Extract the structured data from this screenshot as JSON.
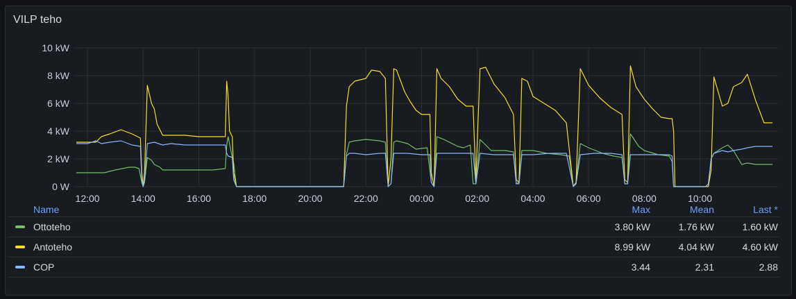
{
  "panel": {
    "title": "VILP teho"
  },
  "legend": {
    "headers": {
      "name": "Name",
      "max": "Max",
      "mean": "Mean",
      "last": "Last *"
    },
    "rows": [
      {
        "name": "Ottoteho",
        "color": "#73bf69",
        "max": "3.80 kW",
        "mean": "1.76 kW",
        "last": "1.60 kW"
      },
      {
        "name": "Antoteho",
        "color": "#fade2a",
        "max": "8.99 kW",
        "mean": "4.04 kW",
        "last": "4.60 kW"
      },
      {
        "name": "COP",
        "color": "#8ab8ff",
        "max": "3.44",
        "mean": "2.31",
        "last": "2.88"
      }
    ]
  },
  "chart_data": {
    "type": "line",
    "ylim": [
      0,
      10
    ],
    "yticks": [
      "0 W",
      "2 kW",
      "4 kW",
      "6 kW",
      "8 kW",
      "10 kW"
    ],
    "xlim": [
      11.5,
      36.8
    ],
    "xticks": [
      {
        "v": 12,
        "label": "12:00"
      },
      {
        "v": 14,
        "label": "14:00"
      },
      {
        "v": 16,
        "label": "16:00"
      },
      {
        "v": 18,
        "label": "18:00"
      },
      {
        "v": 20,
        "label": "20:00"
      },
      {
        "v": 22,
        "label": "22:00"
      },
      {
        "v": 24,
        "label": "00:00"
      },
      {
        "v": 26,
        "label": "02:00"
      },
      {
        "v": 28,
        "label": "04:00"
      },
      {
        "v": 30,
        "label": "06:00"
      },
      {
        "v": 32,
        "label": "08:00"
      },
      {
        "v": 34,
        "label": "10:00"
      }
    ],
    "grid": true,
    "legend_position": "bottom",
    "series": [
      {
        "name": "Ottoteho",
        "color": "#73bf69",
        "x": [
          11.6,
          12.3,
          12.6,
          13.0,
          13.5,
          13.7,
          13.85,
          13.95,
          14.0,
          14.05,
          14.15,
          14.3,
          14.4,
          14.6,
          14.7,
          15.5,
          16.5,
          16.95,
          17.0,
          17.05,
          17.2,
          17.25,
          17.35,
          21.0,
          21.1,
          21.2,
          21.3,
          21.4,
          21.6,
          22.0,
          22.5,
          22.7,
          22.8,
          22.9,
          23.0,
          23.1,
          23.5,
          23.8,
          24.2,
          24.35,
          24.45,
          24.55,
          24.8,
          25.3,
          25.5,
          25.75,
          25.85,
          25.95,
          26.1,
          26.5,
          27.0,
          27.3,
          27.4,
          27.5,
          27.6,
          28.0,
          28.5,
          29.0,
          29.3,
          29.45,
          29.55,
          29.7,
          30.0,
          30.5,
          30.9,
          31.2,
          31.3,
          31.4,
          31.5,
          31.8,
          32.0,
          32.5,
          32.9,
          33.0,
          33.05,
          33.1,
          33.3,
          33.7,
          34.0,
          34.2,
          34.3,
          34.4,
          34.5,
          34.8,
          35.0,
          35.2,
          35.5,
          35.7,
          36.0,
          36.6
        ],
        "y": [
          1.0,
          1.0,
          1.0,
          1.2,
          1.4,
          1.4,
          1.3,
          0.3,
          0.0,
          0.3,
          2.1,
          1.9,
          1.6,
          1.4,
          1.2,
          1.2,
          1.2,
          1.3,
          3.0,
          3.6,
          2.1,
          1.7,
          0.0,
          0.0,
          0.0,
          0.0,
          2.3,
          3.2,
          3.3,
          3.4,
          3.3,
          3.2,
          0.0,
          0.2,
          3.2,
          3.3,
          3.1,
          2.7,
          2.8,
          0.3,
          0.0,
          3.6,
          3.4,
          2.9,
          2.8,
          3.0,
          0.2,
          0.2,
          3.4,
          2.6,
          2.6,
          2.5,
          0.2,
          0.3,
          2.6,
          2.6,
          2.4,
          2.3,
          2.2,
          0.0,
          0.3,
          3.1,
          2.8,
          2.4,
          2.2,
          2.1,
          0.2,
          0.2,
          3.8,
          2.9,
          2.6,
          2.3,
          2.2,
          1.8,
          0.0,
          0.0,
          0.0,
          0.0,
          0.0,
          0.0,
          0.2,
          2.0,
          2.4,
          2.8,
          3.0,
          2.6,
          1.6,
          1.7,
          1.6,
          1.6
        ]
      },
      {
        "name": "Antoteho",
        "color": "#fade2a",
        "x": [
          11.6,
          12.3,
          12.5,
          12.8,
          13.2,
          13.6,
          13.9,
          13.95,
          14.0,
          14.05,
          14.15,
          14.3,
          14.4,
          14.5,
          14.7,
          15.0,
          15.5,
          16.0,
          16.5,
          16.95,
          17.0,
          17.05,
          17.1,
          17.2,
          17.25,
          17.35,
          21.0,
          21.1,
          21.2,
          21.3,
          21.4,
          21.6,
          22.0,
          22.2,
          22.5,
          22.7,
          22.8,
          22.9,
          23.0,
          23.1,
          23.4,
          23.6,
          23.8,
          24.0,
          24.3,
          24.35,
          24.45,
          24.55,
          24.7,
          25.0,
          25.3,
          25.6,
          25.85,
          25.95,
          26.1,
          26.3,
          26.6,
          27.0,
          27.3,
          27.4,
          27.5,
          27.6,
          27.8,
          28.0,
          28.4,
          28.8,
          29.2,
          29.45,
          29.55,
          29.7,
          30.0,
          30.4,
          30.8,
          31.2,
          31.3,
          31.4,
          31.5,
          31.7,
          32.0,
          32.3,
          32.6,
          32.9,
          33.0,
          33.05,
          33.1,
          33.3,
          33.7,
          34.0,
          34.2,
          34.3,
          34.4,
          34.5,
          34.8,
          35.0,
          35.2,
          35.5,
          35.7,
          36.0,
          36.3,
          36.6
        ],
        "y": [
          3.2,
          3.2,
          3.6,
          3.8,
          4.1,
          3.8,
          3.5,
          1.0,
          0.0,
          1.0,
          7.3,
          6.0,
          5.6,
          4.5,
          3.7,
          3.7,
          3.7,
          3.6,
          3.6,
          3.6,
          7.6,
          6.5,
          4.0,
          3.6,
          1.0,
          0.0,
          0.0,
          0.0,
          0.0,
          5.8,
          7.2,
          7.6,
          7.8,
          8.4,
          8.3,
          7.8,
          0.0,
          2.0,
          8.5,
          8.4,
          6.8,
          6.1,
          5.5,
          5.2,
          5.2,
          1.0,
          0.0,
          8.5,
          7.8,
          7.2,
          6.3,
          5.8,
          5.8,
          0.5,
          8.5,
          8.6,
          7.4,
          6.4,
          5.2,
          0.5,
          0.3,
          7.8,
          7.6,
          6.5,
          6.0,
          5.5,
          4.6,
          0.0,
          0.3,
          8.5,
          7.3,
          6.4,
          5.7,
          5.2,
          0.5,
          0.3,
          8.7,
          7.2,
          6.3,
          5.6,
          5.0,
          4.9,
          4.9,
          4.0,
          0.0,
          0.0,
          0.0,
          0.0,
          0.0,
          0.0,
          1.2,
          7.9,
          5.8,
          6.0,
          7.2,
          7.5,
          8.1,
          6.2,
          4.6,
          4.6
        ]
      },
      {
        "name": "COP",
        "color": "#8ab8ff",
        "x": [
          11.6,
          12.0,
          12.3,
          12.5,
          12.8,
          13.2,
          13.6,
          13.9,
          13.95,
          14.0,
          14.05,
          14.15,
          14.4,
          14.7,
          15.0,
          15.5,
          16.0,
          16.5,
          16.95,
          17.0,
          17.05,
          17.2,
          17.25,
          17.35,
          21.0,
          21.1,
          21.2,
          21.3,
          21.4,
          21.6,
          22.0,
          22.5,
          22.7,
          22.8,
          22.9,
          23.0,
          23.1,
          23.5,
          24.0,
          24.3,
          24.35,
          24.45,
          24.55,
          24.8,
          25.3,
          25.85,
          25.95,
          26.1,
          26.6,
          27.0,
          27.3,
          27.4,
          27.5,
          27.6,
          28.0,
          28.6,
          29.2,
          29.45,
          29.55,
          29.7,
          30.2,
          30.8,
          31.2,
          31.3,
          31.4,
          31.5,
          32.0,
          32.5,
          32.9,
          33.0,
          33.05,
          33.1,
          33.3,
          33.7,
          34.0,
          34.2,
          34.3,
          34.4,
          34.5,
          34.8,
          35.0,
          35.2,
          35.5,
          35.7,
          36.0,
          36.3,
          36.6
        ],
        "y": [
          3.1,
          3.1,
          3.3,
          3.1,
          3.2,
          3.3,
          3.0,
          2.9,
          0.5,
          0.0,
          0.5,
          3.1,
          3.2,
          3.0,
          3.1,
          3.0,
          3.0,
          3.0,
          3.0,
          2.4,
          2.2,
          2.1,
          0.5,
          0.0,
          0.0,
          0.0,
          0.0,
          2.2,
          2.4,
          2.4,
          2.3,
          2.4,
          2.4,
          0.0,
          0.2,
          2.4,
          2.4,
          2.4,
          2.3,
          2.3,
          0.3,
          0.0,
          2.4,
          2.4,
          2.4,
          2.4,
          0.2,
          2.4,
          2.3,
          2.3,
          2.3,
          0.2,
          0.2,
          2.3,
          2.3,
          2.4,
          2.4,
          0.0,
          0.2,
          2.3,
          2.4,
          2.4,
          2.3,
          0.2,
          0.2,
          2.3,
          2.3,
          2.3,
          2.3,
          2.2,
          0.0,
          0.0,
          0.0,
          0.0,
          0.0,
          0.0,
          0.2,
          2.0,
          2.4,
          2.6,
          2.5,
          2.6,
          2.7,
          2.8,
          2.9,
          2.9,
          2.9
        ]
      }
    ]
  }
}
